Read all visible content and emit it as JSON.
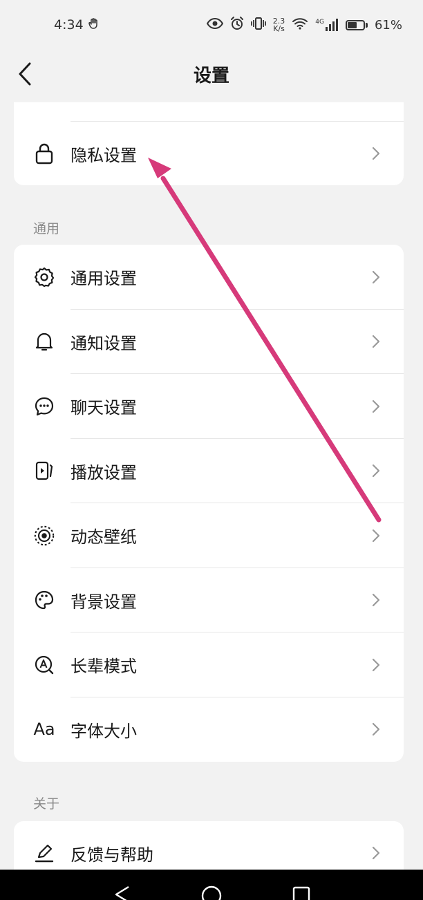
{
  "status_bar": {
    "time": "4:34",
    "net_speed_value": "2.3",
    "net_speed_unit": "K/s",
    "signal_label": "4G",
    "battery_percent": "61%",
    "battery_level": 0.61
  },
  "header": {
    "title": "设置"
  },
  "top_card": {
    "items": [
      {
        "label": "隐私设置",
        "icon": "lock-icon"
      }
    ]
  },
  "sections": {
    "general": "通用",
    "about": "关于"
  },
  "general_items": [
    {
      "label": "通用设置",
      "icon": "gear-icon"
    },
    {
      "label": "通知设置",
      "icon": "bell-icon"
    },
    {
      "label": "聊天设置",
      "icon": "chat-bubble-icon"
    },
    {
      "label": "播放设置",
      "icon": "play-card-icon"
    },
    {
      "label": "动态壁纸",
      "icon": "live-wallpaper-icon"
    },
    {
      "label": "背景设置",
      "icon": "palette-icon"
    },
    {
      "label": "长辈模式",
      "icon": "elder-mode-icon"
    },
    {
      "label": "字体大小",
      "icon": "font-size-icon",
      "glyph": "Aa"
    }
  ],
  "about_items": [
    {
      "label": "反馈与帮助",
      "icon": "pen-icon"
    }
  ],
  "annotation": {
    "arrow_color": "#d63a7a"
  }
}
